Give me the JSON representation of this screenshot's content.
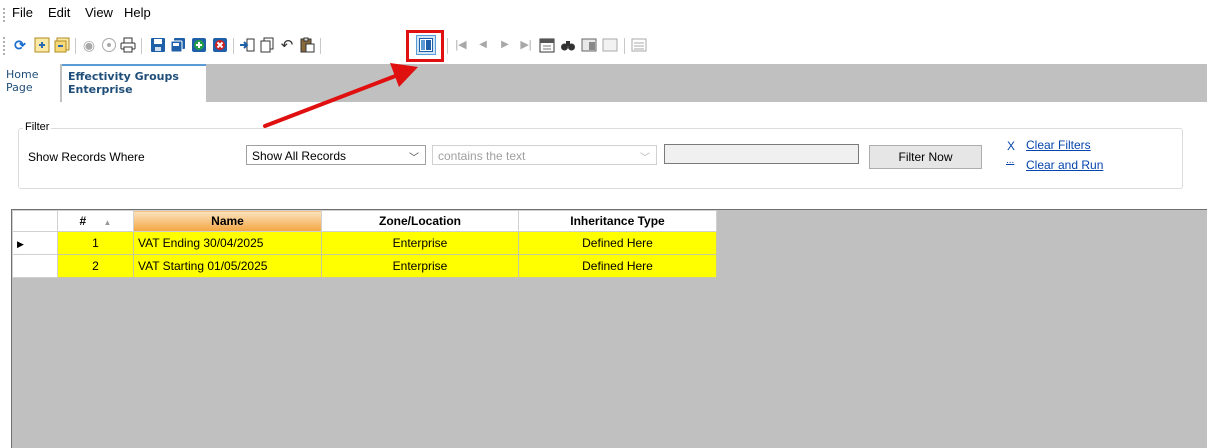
{
  "menu": {
    "file": "File",
    "edit": "Edit",
    "view": "View",
    "help": "Help"
  },
  "toolbar_icons": [
    "refresh-icon",
    "tree-icon",
    "multi-tree-icon",
    "radio-icon",
    "comment-icon",
    "print-icon",
    "save-icon",
    "save-all-icon",
    "add-icon",
    "delete-icon",
    "import-icon",
    "copy-icon",
    "undo-icon",
    "paste-icon",
    "layout-icon",
    "first-record-icon",
    "previous-record-icon",
    "next-record-icon",
    "last-record-icon",
    "calendar-icon",
    "find-icon",
    "window-icon",
    "list-icon"
  ],
  "tabs": {
    "home_line1": "Home",
    "home_line2": "Page",
    "active_line1": "Effectivity Groups",
    "active_line2": "Enterprise"
  },
  "filter": {
    "legend": "Filter",
    "show_records_label": "Show Records Where",
    "records_select": "Show All Records",
    "operator_select": "contains the text",
    "value": "",
    "filter_now": "Filter Now",
    "clear_filters_icon": "X",
    "clear_filters": "Clear Filters",
    "clear_run_icon": "...",
    "clear_and_run": "Clear and Run"
  },
  "grid": {
    "columns": [
      "#",
      "Name",
      "Zone/Location",
      "Inheritance Type"
    ],
    "sort_indicator": "▲",
    "rows": [
      {
        "num": "1",
        "name": "VAT Ending 30/04/2025",
        "zone": "Enterprise",
        "inheritance": "Defined Here"
      },
      {
        "num": "2",
        "name": "VAT Starting 01/05/2025",
        "zone": "Enterprise",
        "inheritance": "Defined Here"
      }
    ]
  },
  "colors": {
    "highlight": "#e01010",
    "row_yellow": "#ffff00",
    "sorted_header": "#f4a640",
    "link": "#0645ad"
  }
}
